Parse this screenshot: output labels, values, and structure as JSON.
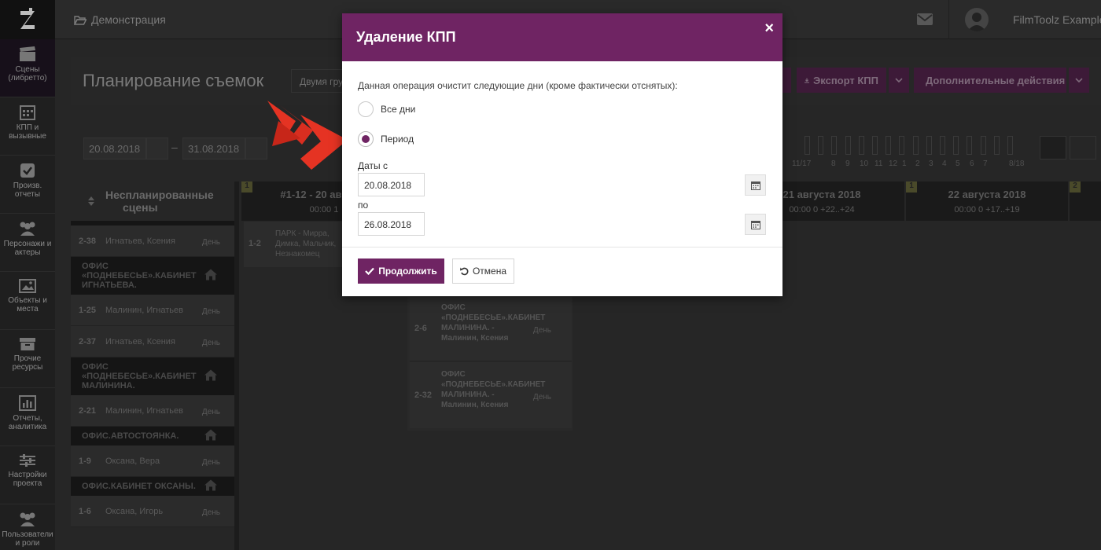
{
  "sidebar": {
    "items": [
      {
        "label": "Сцены (либретто)",
        "icon": "clapperboard-icon"
      },
      {
        "label": "КПП и вызывные",
        "icon": "calendar-grid-icon"
      },
      {
        "label": "Произв. отчеты",
        "icon": "checkbox-icon"
      },
      {
        "label": "Персонажи и актеры",
        "icon": "people-icon"
      },
      {
        "label": "Объекты и места",
        "icon": "image-icon"
      },
      {
        "label": "Прочие ресурсы",
        "icon": "box-icon"
      },
      {
        "label": "Отчеты, аналитика",
        "icon": "bar-chart-icon"
      },
      {
        "label": "Настройки проекта",
        "icon": "sliders-icon"
      },
      {
        "label": "Пользователи и роли",
        "icon": "users-icon"
      }
    ]
  },
  "topbar": {
    "breadcrumb": "Демонстрация",
    "user_name": "FilmToolz Example"
  },
  "page": {
    "title": "Планирование съемок",
    "group_select": "Двумя группами",
    "export_label": "Экспорт КПП",
    "more_actions_label": "Дополнительные действия"
  },
  "filters": {
    "date_from": "20.08.2018",
    "date_to": "31.08.2018",
    "dash": "–",
    "mini_labels": [
      "11/17",
      "8",
      "9",
      "10",
      "11",
      "12",
      "1",
      "2",
      "3",
      "4",
      "5",
      "6",
      "7",
      "8/18"
    ]
  },
  "unplanned": {
    "title_line1": "Неспланированные",
    "title_line2": "сцены",
    "rows": [
      {
        "type": "scene",
        "num": "2-38",
        "text": "Игнатьев, Ксения",
        "tod": "День"
      },
      {
        "type": "loc",
        "text": "ОФИС «ПОДНЕБЕСЬЕ».КАБИНЕТ ИГНАТЬЕВА."
      },
      {
        "type": "scene",
        "num": "1-25",
        "text": "Малинин, Игнатьев",
        "tod": "День"
      },
      {
        "type": "scene",
        "num": "2-37",
        "text": "Игнатьев, Ксения",
        "tod": "День"
      },
      {
        "type": "loc",
        "text": "ОФИС «ПОДНЕБЕСЬЕ».КАБИНЕТ МАЛИНИНА."
      },
      {
        "type": "scene",
        "num": "2-21",
        "text": "Малинин, Игнатьев",
        "tod": "День"
      },
      {
        "type": "loc",
        "text": "ОФИС.АВТОСТОЯНКА."
      },
      {
        "type": "scene",
        "num": "1-9",
        "text": "Оксана, Вера",
        "tod": "День"
      },
      {
        "type": "loc",
        "text": "ОФИС.КАБИНЕТ ОКСАНЫ."
      },
      {
        "type": "scene",
        "num": "1-6",
        "text": "Оксана, Игорь",
        "tod": "День"
      }
    ]
  },
  "calendar": {
    "day1": {
      "num": "1",
      "title": "#1-12 - 20 августа",
      "sub": "00:00  1"
    },
    "day2": {
      "num": "",
      "title": "21 августа 2018",
      "sub": "00:00  0   +22..+24"
    },
    "day3": {
      "num": "1",
      "title": "22 августа 2018",
      "sub": "00:00  0   +17..+19"
    },
    "day4": {
      "num": "2",
      "title": "",
      "sub": ""
    },
    "card1": {
      "num": "1-2",
      "text": "ПАРК - Мирра, Димка, Мальчик, Незнакомец"
    },
    "card2": {
      "num": "2-6",
      "text": "ОФИС «ПОДНЕБЕСЬЕ».КАБИНЕТ МАЛИНИНА. - Малинин, Ксения",
      "tod": "День"
    },
    "card3": {
      "num": "2-32",
      "text": "ОФИС «ПОДНЕБЕСЬЕ».КАБИНЕТ МАЛИНИНА. - Малинин, Ксения",
      "tod": "День"
    }
  },
  "modal": {
    "title": "Удаление КПП",
    "close": "×",
    "description": "Данная операция очистит следующие дни (кроме фактически отснятых):",
    "option_all": "Все дни",
    "option_period": "Период",
    "selected_option": "Период",
    "dates_from_label": "Даты с",
    "date_from": "20.08.2018",
    "to_label": "по",
    "date_to": "26.08.2018",
    "continue_label": "Продолжить",
    "cancel_label": "Отмена"
  },
  "colors": {
    "accent": "#6f2463",
    "arrow": "#e53323"
  }
}
